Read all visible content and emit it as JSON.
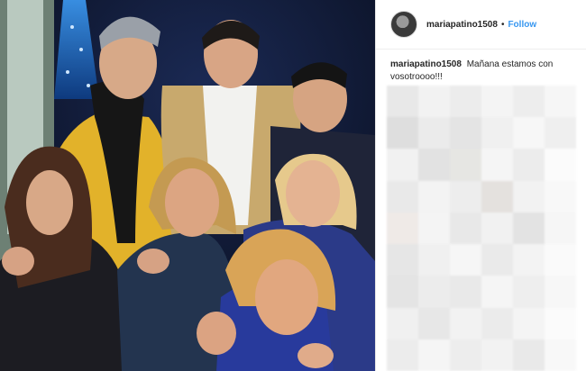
{
  "post": {
    "username": "mariapatino1508",
    "separator": "•",
    "follow_label": "Follow",
    "caption_user": "mariapatino1508",
    "caption_text": "Mañana estamos con vosotroooo!!!"
  },
  "colors": {
    "follow": "#3897f0",
    "text": "#262626",
    "photo_background": "#0f1730"
  },
  "icons": {
    "avatar": "profile-avatar"
  }
}
